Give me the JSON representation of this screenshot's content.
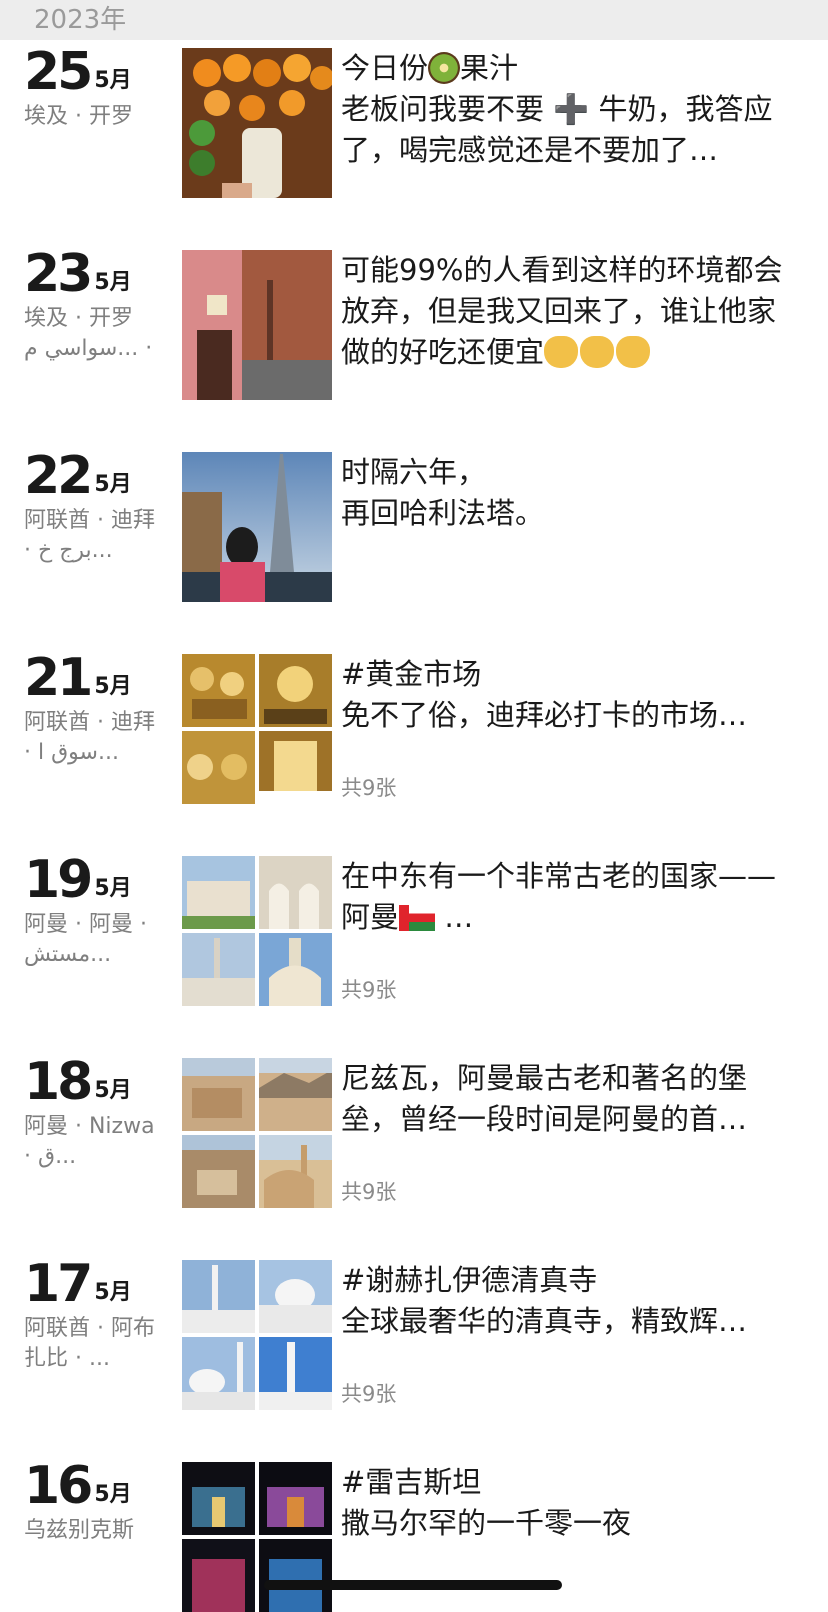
{
  "year_header": "2023年",
  "entries": [
    {
      "day": "25",
      "month": "5月",
      "location": "埃及 · 开罗",
      "text_before": "今日份",
      "emoji": "kiwi",
      "text_after": "果汁\n老板问我要不要 ➕ 牛奶，我答应了，喝完感觉还是不要加了…",
      "count": ""
    },
    {
      "day": "23",
      "month": "5月",
      "location": "埃及 · 开罗\nسواسي م... ·",
      "text_before": "可能99%的人看到这样的环境都会放弃，但是我又回来了，谁让他家做的好吃还便宜",
      "emoji": "cat",
      "text_after": "",
      "count": ""
    },
    {
      "day": "22",
      "month": "5月",
      "location": "阿联酋 · 迪拜 · برج خ...",
      "text_before": "时隔六年，\n再回哈利法塔。",
      "emoji": "",
      "text_after": "",
      "count": ""
    },
    {
      "day": "21",
      "month": "5月",
      "location": "阿联酋 · 迪拜 · سوق ا...",
      "text_before": "#黄金市场\n免不了俗，迪拜必打卡的市场…",
      "emoji": "",
      "text_after": "",
      "count": "共9张"
    },
    {
      "day": "19",
      "month": "5月",
      "location": "阿曼 · 阿曼 · مستش...",
      "text_before": "在中东有一个非常古老的国家——阿曼",
      "emoji": "flag",
      "text_after": " …",
      "count": "共9张"
    },
    {
      "day": "18",
      "month": "5月",
      "location": "阿曼 · Nizwa · ق...",
      "text_before": "尼兹瓦，阿曼最古老和著名的堡垒，曾经一段时间是阿曼的首…",
      "emoji": "",
      "text_after": "",
      "count": "共9张"
    },
    {
      "day": "17",
      "month": "5月",
      "location": "阿联酋 · 阿布扎比 · ...",
      "text_before": "#谢赫扎伊德清真寺\n全球最奢华的清真寺，精致辉…",
      "emoji": "",
      "text_after": "",
      "count": "共9张"
    },
    {
      "day": "16",
      "month": "5月",
      "location": "乌兹别克斯",
      "text_before": "#雷吉斯坦\n撒马尔罕的一千零一夜",
      "emoji": "",
      "text_after": "",
      "count": ""
    }
  ],
  "colors": {
    "year_bar_bg": "#ededed",
    "text": "#1a1a1a",
    "muted": "#7f7f7f"
  }
}
